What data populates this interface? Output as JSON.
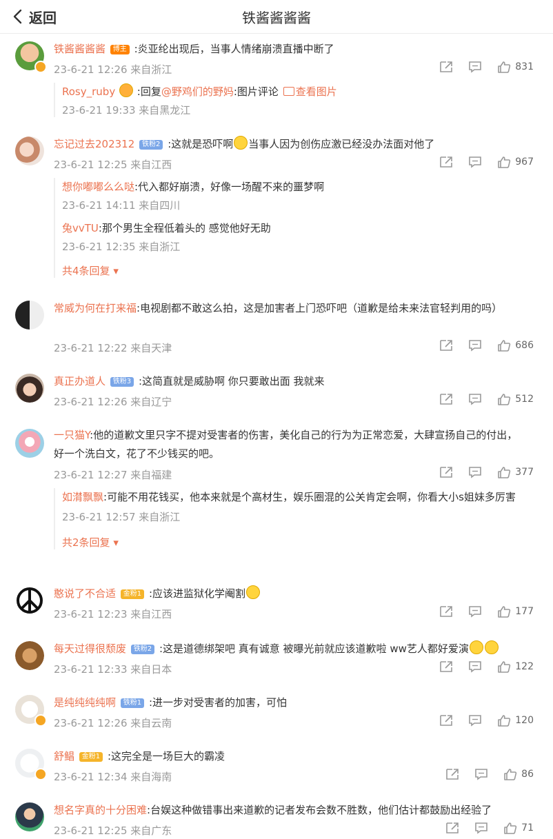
{
  "header": {
    "back_label": "返回",
    "title": "铁酱酱酱酱"
  },
  "colors": {
    "name": "#eb7350",
    "meta": "#999999",
    "fan_tag": "#7aa6e8",
    "gold_tag": "#f5b42a",
    "bozhu_tag": "#ff8200"
  },
  "comments": [
    {
      "name": "铁酱酱酱酱",
      "tag": "博主",
      "text": ":炎亚纶出现后，当事人情绪崩溃直播中断了",
      "meta": "23-6-21 12:26 来自浙江",
      "likes": "831",
      "replies": [
        {
          "name": "Rosy_ruby",
          "text_a": ":回复",
          "mention": "@野鸡们的野妈",
          "text_b": ":图片评论",
          "image_link": "查看图片",
          "meta": "23-6-21 19:33 来自黑龙江"
        }
      ]
    },
    {
      "name": "忘记过去202312",
      "tag": "铁粉2",
      "text_a": ":这就是恐吓啊",
      "text_b": "当事人因为创伤应激已经没办法面对他了",
      "meta": "23-6-21 12:25 来自江西",
      "likes": "967",
      "replies": [
        {
          "name": "想你嘟嘟么么哒",
          "text": ":代入都好崩溃，好像一场醒不来的噩梦啊",
          "meta": "23-6-21 14:11 来自四川"
        },
        {
          "name": "兔vvTU",
          "text": ":那个男生全程低着头的 感觉他好无助",
          "meta": "23-6-21 12:35 来自浙江"
        }
      ],
      "more": "共4条回复"
    },
    {
      "name": "常威为何在打来福",
      "text": ":电视剧都不敢这么拍，这是加害者上门恐吓吧（道歉是给未来法官轻判用的吗）",
      "meta": "23-6-21 12:22 来自天津",
      "likes": "686"
    },
    {
      "name": "真正办道人",
      "tag": "铁粉3",
      "text": ":这简直就是威胁啊 你只要敢出面 我就来",
      "meta": "23-6-21 12:26 来自辽宁",
      "likes": "512"
    },
    {
      "name": "一只猫Y",
      "text": ":他的道歉文里只字不提对受害者的伤害，美化自己的行为为正常恋爱，大肆宣扬自己的付出，好一个洗白文，花了不少钱买的吧。",
      "meta": "23-6-21 12:27 来自福建",
      "likes": "377",
      "replies": [
        {
          "name": "如潸飘飘",
          "text": ":可能不用花钱买，他本来就是个高材生，娱乐圈混的公关肯定会啊，你看大小s姐妹多厉害",
          "meta": "23-6-21 12:57 来自浙江"
        }
      ],
      "more": "共2条回复"
    },
    {
      "name": "憨说了不合适",
      "tag": "金粉1",
      "text": ":应该进监狱化学阉割",
      "meta": "23-6-21 12:23 来自江西",
      "likes": "177"
    },
    {
      "name": "每天过得很颓废",
      "tag": "铁粉2",
      "text": ":这是道德绑架吧 真有诚意 被曝光前就应该道歉啦 ww艺人都好爱演",
      "meta": "23-6-21 12:33 来自日本",
      "likes": "122"
    },
    {
      "name": "是纯纯纯纯啊",
      "tag": "铁粉1",
      "text": ":进一步对受害者的加害，可怕",
      "meta": "23-6-21 12:26 来自云南",
      "likes": "120"
    },
    {
      "name": "舒鲳",
      "tag": "金粉1",
      "text": ":这完全是一场巨大的霸凌",
      "meta": "23-6-21 12:34 来自海南",
      "likes": "86"
    },
    {
      "name": "想名字真的十分困难",
      "text": ":台娱这种做错事出来道歉的记者发布会数不胜数，他们估计都鼓励出经验了",
      "meta": "23-6-21 12:25 来自广东",
      "likes": "71"
    }
  ]
}
